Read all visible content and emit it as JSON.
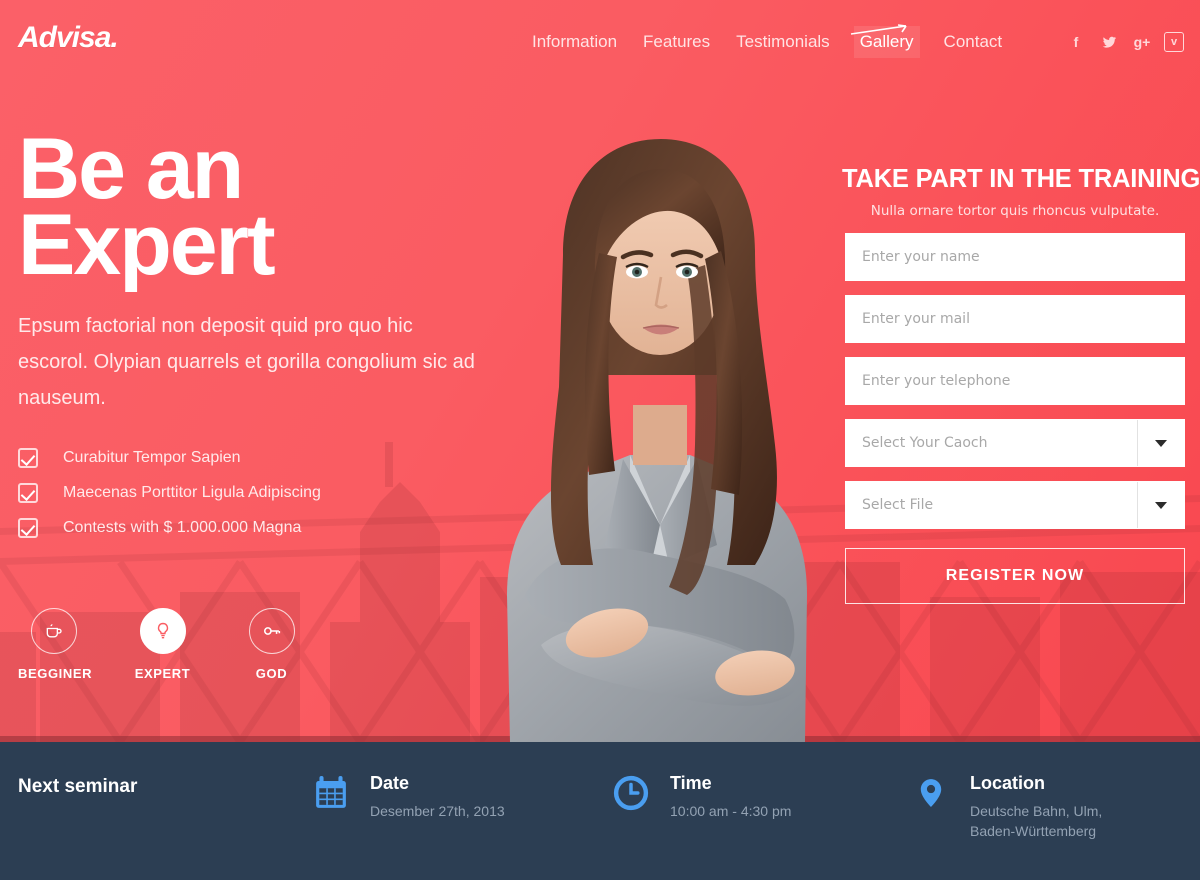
{
  "brand": {
    "name": "Advisa."
  },
  "nav": {
    "items": [
      {
        "label": "Information",
        "active": false
      },
      {
        "label": "Features",
        "active": false
      },
      {
        "label": "Testimonials",
        "active": false
      },
      {
        "label": "Gallery",
        "active": true
      },
      {
        "label": "Contact",
        "active": false
      }
    ],
    "social": [
      {
        "name": "facebook-icon",
        "glyph": "f"
      },
      {
        "name": "twitter-icon",
        "glyph": "✈"
      },
      {
        "name": "google-plus-icon",
        "glyph": "g+"
      },
      {
        "name": "vimeo-icon",
        "glyph": "v"
      }
    ]
  },
  "hero": {
    "headline_line1": "Be an",
    "headline_line2": "Expert",
    "lead": "Epsum factorial non deposit quid pro quo hic escorol. Olypian quarrels et gorilla congolium sic ad nauseum.",
    "checklist": [
      "Curabitur Tempor Sapien",
      "Maecenas Porttitor Ligula Adipiscing",
      "Contests with $ 1.000.000 Magna"
    ],
    "levels": [
      {
        "label": "BEGGINER",
        "icon": "coffee-cup-icon",
        "active": false
      },
      {
        "label": "EXPERT",
        "icon": "lightbulb-icon",
        "active": true
      },
      {
        "label": "GOD",
        "icon": "key-icon",
        "active": false
      }
    ]
  },
  "form": {
    "title": "TAKE PART IN THE TRAINING",
    "subtitle": "Nulla ornare tortor quis rhoncus vulputate.",
    "fields": [
      {
        "name": "name-field",
        "placeholder": "Enter your name",
        "value": "",
        "type": "text"
      },
      {
        "name": "email-field",
        "placeholder": "Enter your mail",
        "value": "",
        "type": "text"
      },
      {
        "name": "telephone-field",
        "placeholder": "Enter your telephone",
        "value": "",
        "type": "text"
      },
      {
        "name": "coach-select",
        "placeholder": "Select Your Caoch",
        "value": "",
        "type": "select"
      },
      {
        "name": "file-select",
        "placeholder": "Select File",
        "value": "",
        "type": "select"
      }
    ],
    "submit_label": "REGISTER NOW"
  },
  "footer": {
    "heading": "Next seminar",
    "items": [
      {
        "icon": "calendar-icon",
        "title": "Date",
        "text": "Desember 27th, 2013"
      },
      {
        "icon": "clock-icon",
        "title": "Time",
        "text": "10:00 am - 4:30 pm"
      },
      {
        "icon": "map-pin-icon",
        "title": "Location",
        "text": "Deutsche Bahn, Ulm, Baden-Württemberg"
      }
    ]
  },
  "colors": {
    "brand_red": "#fa5c62",
    "brand_red_dark": "#f9474f",
    "footer_navy": "#2c3e53",
    "footer_accent_blue": "#4a9ef0",
    "footer_muted": "#93a2b3"
  }
}
